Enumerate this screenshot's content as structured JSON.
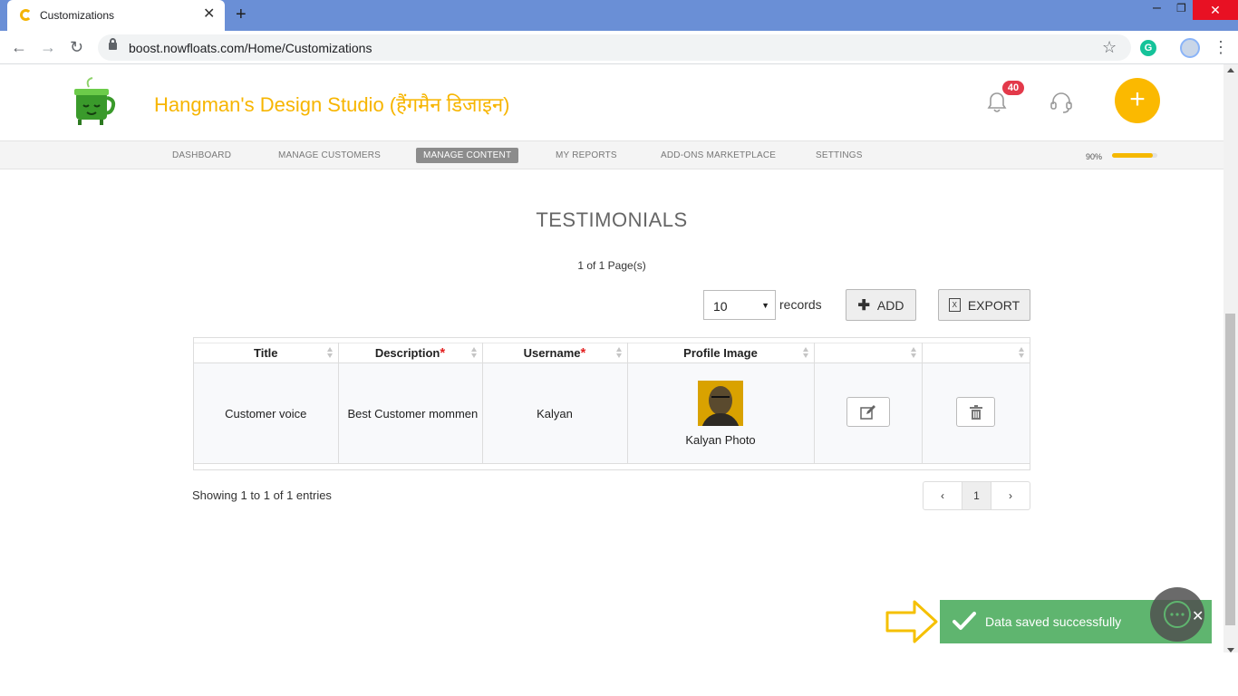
{
  "browser": {
    "tab_title": "Customizations",
    "url": "boost.nowfloats.com/Home/Customizations"
  },
  "header": {
    "brand": "Hangman's Design Studio (हैंगमैन डिजाइन)",
    "notification_count": "40"
  },
  "nav": {
    "items": [
      "DASHBOARD",
      "MANAGE CUSTOMERS",
      "MANAGE CONTENT",
      "MY REPORTS",
      "ADD-ONS MARKETPLACE",
      "SETTINGS"
    ],
    "active": "MANAGE CONTENT",
    "progress_label": "90%",
    "progress_value": 0.9
  },
  "page": {
    "title": "TESTIMONIALS",
    "pages_info": "1 of 1 Page(s)",
    "records_value": "10",
    "records_label": "records",
    "add_label": "ADD",
    "export_label": "EXPORT"
  },
  "table": {
    "headers": [
      "Title",
      "Description",
      "Username",
      "Profile Image",
      "",
      ""
    ],
    "required_marker": "*",
    "rows": [
      {
        "title": "Customer voice",
        "description": "Best Customer mommen",
        "username": "Kalyan",
        "profile_label": "Kalyan Photo"
      }
    ]
  },
  "footer": {
    "entries_text": "Showing 1 to 1 of 1 entries",
    "pages": [
      "‹",
      "1",
      "›"
    ]
  },
  "toast": {
    "message": "Data saved successfully"
  },
  "colors": {
    "brand": "#f7b500",
    "toast": "#5fb56f",
    "badge": "#e3394a",
    "tabbar": "#6a8fd6"
  },
  "icons": [
    "bell-icon",
    "headset-icon",
    "plus-icon",
    "edit-icon",
    "trash-icon",
    "check-icon",
    "chat-icon",
    "arrow-callout-icon",
    "excel-icon"
  ]
}
